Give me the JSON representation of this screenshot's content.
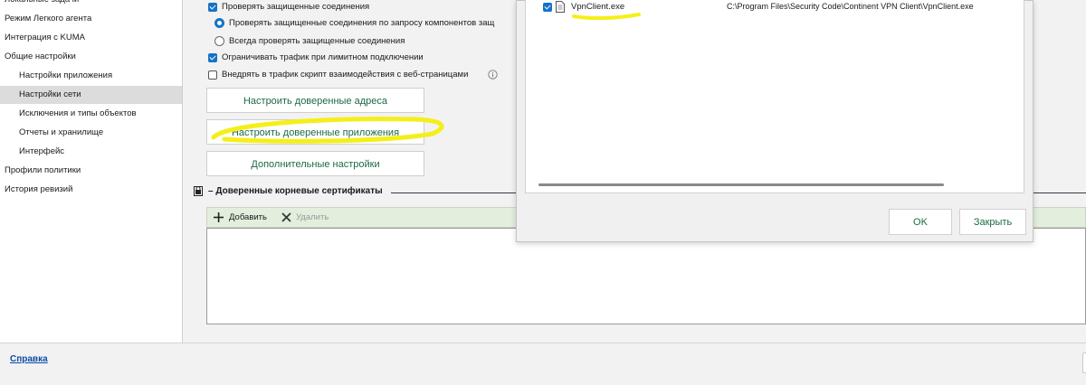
{
  "sidebar": {
    "items": [
      {
        "label": "Локальные задачи"
      },
      {
        "label": "Режим Легкого агента"
      },
      {
        "label": "Интеграция с KUMA"
      },
      {
        "label": "Общие настройки"
      },
      {
        "label": "Настройки приложения"
      },
      {
        "label": "Настройки сети",
        "selected": true
      },
      {
        "label": "Исключения и типы объектов"
      },
      {
        "label": "Отчеты и хранилище"
      },
      {
        "label": "Интерфейс"
      },
      {
        "label": "Профили политики"
      },
      {
        "label": "История ревизий"
      }
    ]
  },
  "network": {
    "check_secure_connections": {
      "label": "Проверять защищенные соединения",
      "checked": true
    },
    "radio_on_request": {
      "label": "Проверять защищенные соединения по запросу компонентов защ",
      "selected": true
    },
    "radio_always": {
      "label": "Всегда проверять защищенные соединения",
      "selected": false
    },
    "limit_traffic": {
      "label": "Ограничивать трафик при лимитном подключении",
      "checked": true
    },
    "inject_script": {
      "label": "Внедрять в трафик скрипт взаимодействия с веб-страницами",
      "checked": false
    },
    "trusted_addresses_button": "Настроить доверенные адреса",
    "trusted_apps_button": "Настроить доверенные приложения",
    "advanced_button": "Дополнительные настройки"
  },
  "certificates": {
    "title": "Доверенные корневые сертификаты",
    "add_label": "Добавить",
    "delete_label": "Удалить"
  },
  "footer": {
    "help_link": "Справка"
  },
  "dialog": {
    "row": {
      "name": "VpnClient.exe",
      "path": "C:\\Program Files\\Security Code\\Continent VPN Client\\VpnClient.exe",
      "checked": true
    },
    "ok_label": "OK",
    "close_label": "Закрыть"
  },
  "colors": {
    "accent": "#1473c7",
    "button_text": "#1c6a45",
    "highlighter": "#f4ef1a",
    "toolbar_bg": "#e3eedd"
  }
}
